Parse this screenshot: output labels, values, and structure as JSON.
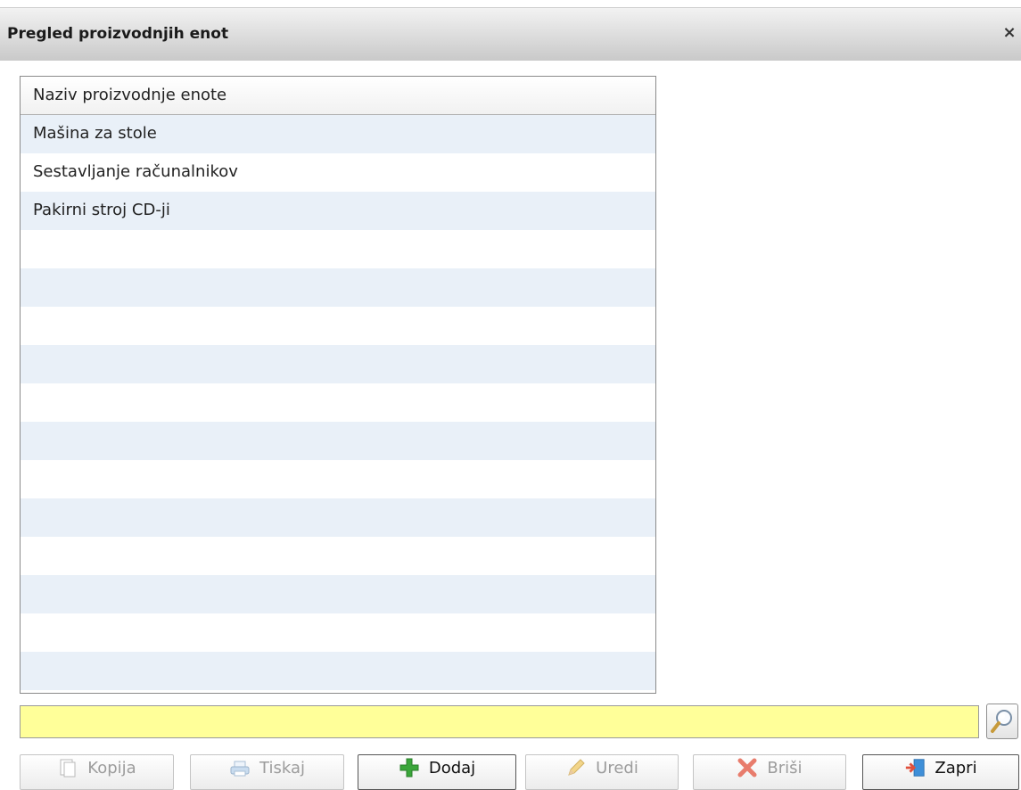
{
  "dialog": {
    "title": "Pregled proizvodnjih enot",
    "close_label": "×"
  },
  "grid": {
    "column_header": "Naziv proizvodnje enote",
    "rows": [
      "Mašina za stole",
      "Sestavljanje računalnikov",
      "Pakirni stroj CD-ji",
      "",
      "",
      "",
      "",
      "",
      "",
      "",
      "",
      "",
      "",
      "",
      ""
    ]
  },
  "search": {
    "value": "",
    "background_color": "#ffff99"
  },
  "buttons": {
    "kopija": {
      "label": "Kopija",
      "icon": "copy-icon",
      "enabled": false
    },
    "tiskaj": {
      "label": "Tiskaj",
      "icon": "printer-icon",
      "enabled": false
    },
    "dodaj": {
      "label": "Dodaj",
      "icon": "plus-icon",
      "enabled": true
    },
    "uredi": {
      "label": "Uredi",
      "icon": "pencil-icon",
      "enabled": false
    },
    "brisi": {
      "label": "Briši",
      "icon": "delete-x-icon",
      "enabled": false
    },
    "zapri": {
      "label": "Zapri",
      "icon": "exit-door-icon",
      "enabled": true
    }
  },
  "colors": {
    "row_alt": "#e9f0f8",
    "plus_green": "#3aa63a",
    "delete_red": "#e0503c"
  }
}
